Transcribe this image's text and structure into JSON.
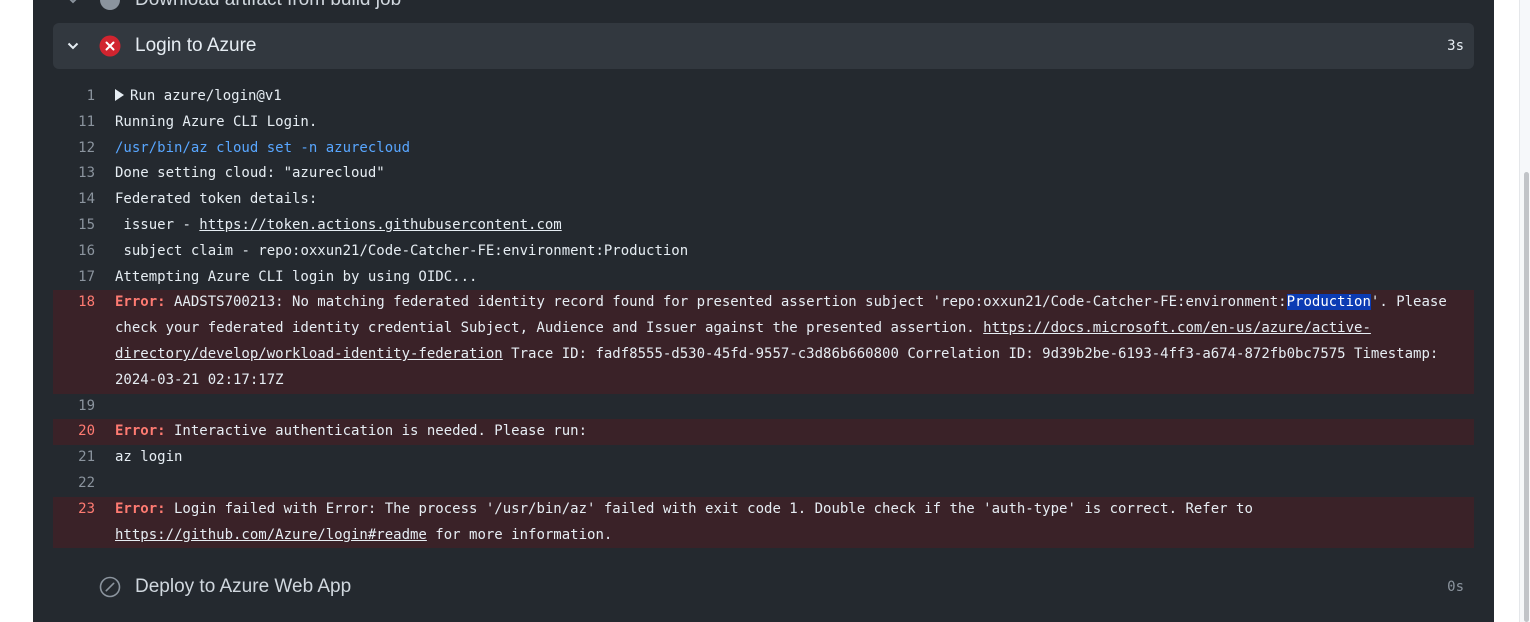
{
  "steps": {
    "previous": {
      "title": "Download artifact from build job"
    },
    "active": {
      "title": "Login to Azure",
      "duration": "3s",
      "status": "failed"
    },
    "next": {
      "title": "Deploy to Azure Web App",
      "duration": "0s",
      "status": "skipped"
    }
  },
  "log": {
    "line1": {
      "num": "1",
      "text": "Run azure/login@v1"
    },
    "line11": {
      "num": "11",
      "text": "Running Azure CLI Login."
    },
    "line12": {
      "num": "12",
      "text": "/usr/bin/az cloud set -n azurecloud"
    },
    "line13": {
      "num": "13",
      "text": "Done setting cloud: \"azurecloud\""
    },
    "line14": {
      "num": "14",
      "text": "Federated token details:"
    },
    "line15": {
      "num": "15",
      "prefix": " issuer - ",
      "link": "https://token.actions.githubusercontent.com"
    },
    "line16": {
      "num": "16",
      "text": " subject claim - repo:oxxun21/Code-Catcher-FE:environment:Production"
    },
    "line17": {
      "num": "17",
      "text": "Attempting Azure CLI login by using OIDC..."
    },
    "line18": {
      "num": "18",
      "label": "Error:",
      "part1": " AADSTS700213: No matching federated identity record found for presented assertion subject 'repo:oxxun21/Code-Catcher-FE:environment:",
      "highlight": "Production",
      "part2": "'. Please check your federated identity credential Subject, Audience and Issuer against the presented assertion. ",
      "link": "https://docs.microsoft.com/en-us/azure/active-directory/develop/workload-identity-federation",
      "part3": " Trace ID: fadf8555-d530-45fd-9557-c3d86b660800 Correlation ID: 9d39b2be-6193-4ff3-a674-872fb0bc7575 Timestamp: 2024-03-21 02:17:17Z"
    },
    "line19": {
      "num": "19",
      "text": ""
    },
    "line20": {
      "num": "20",
      "label": "Error:",
      "text": " Interactive authentication is needed. Please run:"
    },
    "line21": {
      "num": "21",
      "text": "az login"
    },
    "line22": {
      "num": "22",
      "text": ""
    },
    "line23": {
      "num": "23",
      "label": "Error:",
      "part1": " Login failed with Error: The process '/usr/bin/az' failed with exit code 1. Double check if the 'auth-type' is correct. Refer to ",
      "link": "https://github.com/Azure/login#readme",
      "part2": " for more information."
    }
  },
  "colors": {
    "panel_bg": "#24292f",
    "error_red": "#ff7b72",
    "error_icon": "#d1242f",
    "command_blue": "#58a6ff",
    "error_row_bg": "#3a2228",
    "highlight": "#0b3bb3"
  },
  "icons": {
    "chevron": "chevron-down-icon",
    "failed": "x-circle-fill-icon",
    "skipped": "skip-circle-icon"
  }
}
